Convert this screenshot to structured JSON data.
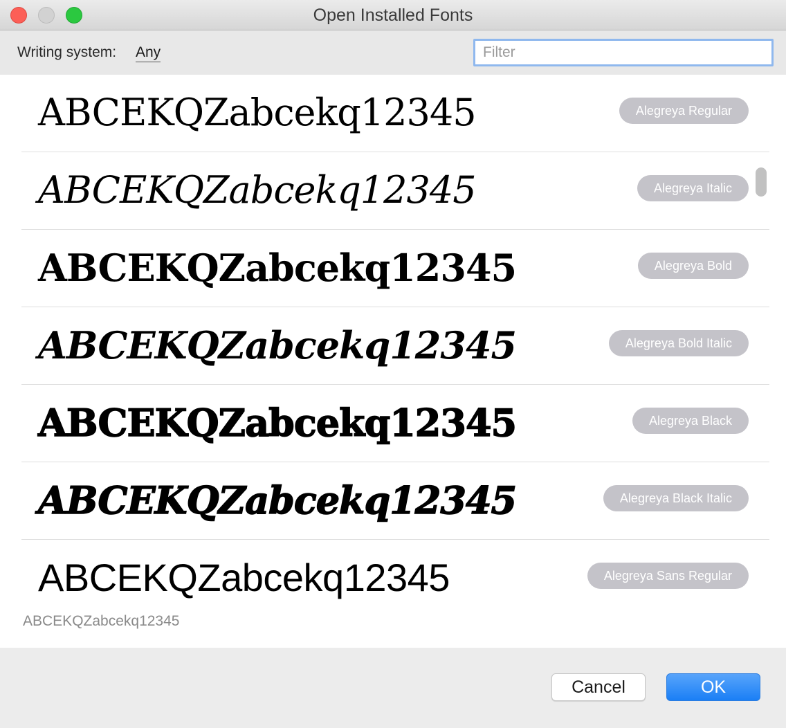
{
  "window": {
    "title": "Open Installed Fonts"
  },
  "toolbar": {
    "writing_system_label": "Writing system:",
    "writing_system_value": "Any",
    "filter_placeholder": "Filter"
  },
  "fonts": [
    {
      "sample": "ABCEKQZabcekq12345",
      "name": "Alegreya Regular"
    },
    {
      "sample": "ABCEKQZabcekq12345",
      "name": "Alegreya Italic"
    },
    {
      "sample": "ABCEKQZabcekq12345",
      "name": "Alegreya Bold"
    },
    {
      "sample": "ABCEKQZabcekq12345",
      "name": "Alegreya Bold Italic"
    },
    {
      "sample": "ABCEKQZabcekq12345",
      "name": "Alegreya Black"
    },
    {
      "sample": "ABCEKQZabcekq12345",
      "name": "Alegreya Black Italic"
    },
    {
      "sample": "ABCEKQZabcekq12345",
      "name": "Alegreya Sans Regular"
    }
  ],
  "preview_text": "ABCEKQZabcekq12345",
  "footer": {
    "cancel_label": "Cancel",
    "ok_label": "OK"
  },
  "colors": {
    "accent": "#1a7ff5",
    "badge": "#c4c3c9",
    "close": "#fc5f57",
    "zoom": "#2bc840"
  }
}
